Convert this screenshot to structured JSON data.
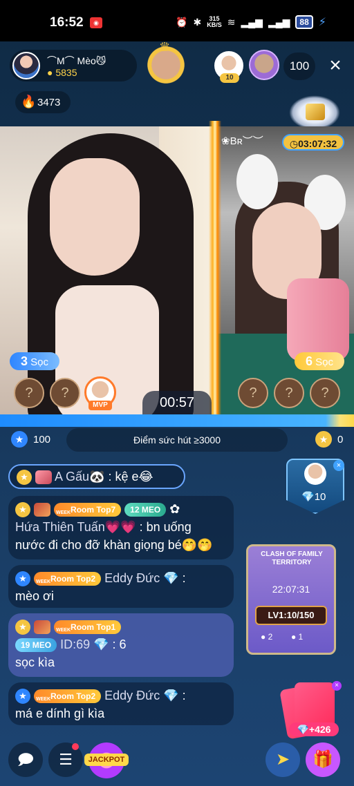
{
  "status_bar": {
    "time": "16:52",
    "net_speed": "315",
    "net_unit": "KB/S",
    "battery": "88"
  },
  "host": {
    "name": "⌒M⌒ Mèo😼",
    "coins": "5835",
    "fire_count": "3473"
  },
  "viewers": {
    "top_level": "10",
    "count": "100"
  },
  "pk": {
    "opponent_name": "❀Bʀ︶︶",
    "opponent_timer": "03:07:32",
    "left_score_num": "3",
    "left_score_unit": "Sọc",
    "right_score_num": "6",
    "right_score_unit": "Sọc",
    "countdown": "00:57",
    "mvp_label": "MVP",
    "left_points": "100",
    "right_points": "0",
    "goal_text": "Điểm sức hút ≥3000"
  },
  "chat": [
    {
      "user": "A Gấu🐼",
      "text": ": kệ e😂"
    },
    {
      "tag": "Room Top7",
      "fan_level": "12",
      "fan_name": "MEO",
      "user": "Hứa Thiên Tuấn💗💗",
      "text": ": bn uống",
      "text2": "nước đi cho đỡ khàn giọng bé🤭🤭"
    },
    {
      "tag": "Room Top2",
      "user": "Eddy Đức",
      "text": ":",
      "text2": "mèo ơi"
    },
    {
      "tag": "Room Top1",
      "fan_level": "19",
      "fan_name": "MEO",
      "user": "ID:69",
      "text": ": 6",
      "text2": "sọc kìa"
    },
    {
      "tag": "Room Top2",
      "user": "Eddy Đức",
      "text": ":",
      "text2": "má e dính gì kìa"
    }
  ],
  "widgets": {
    "mini_value": "10",
    "clash_title": "CLASH OF FAMILY TERRITORY",
    "clash_time": "22:07:31",
    "clash_level": "LV1:10/150",
    "clash_stat1": "2",
    "clash_stat2": "1",
    "lucky_plus": "+426"
  },
  "bottom": {
    "jackpot_label": "JACKPOT"
  }
}
